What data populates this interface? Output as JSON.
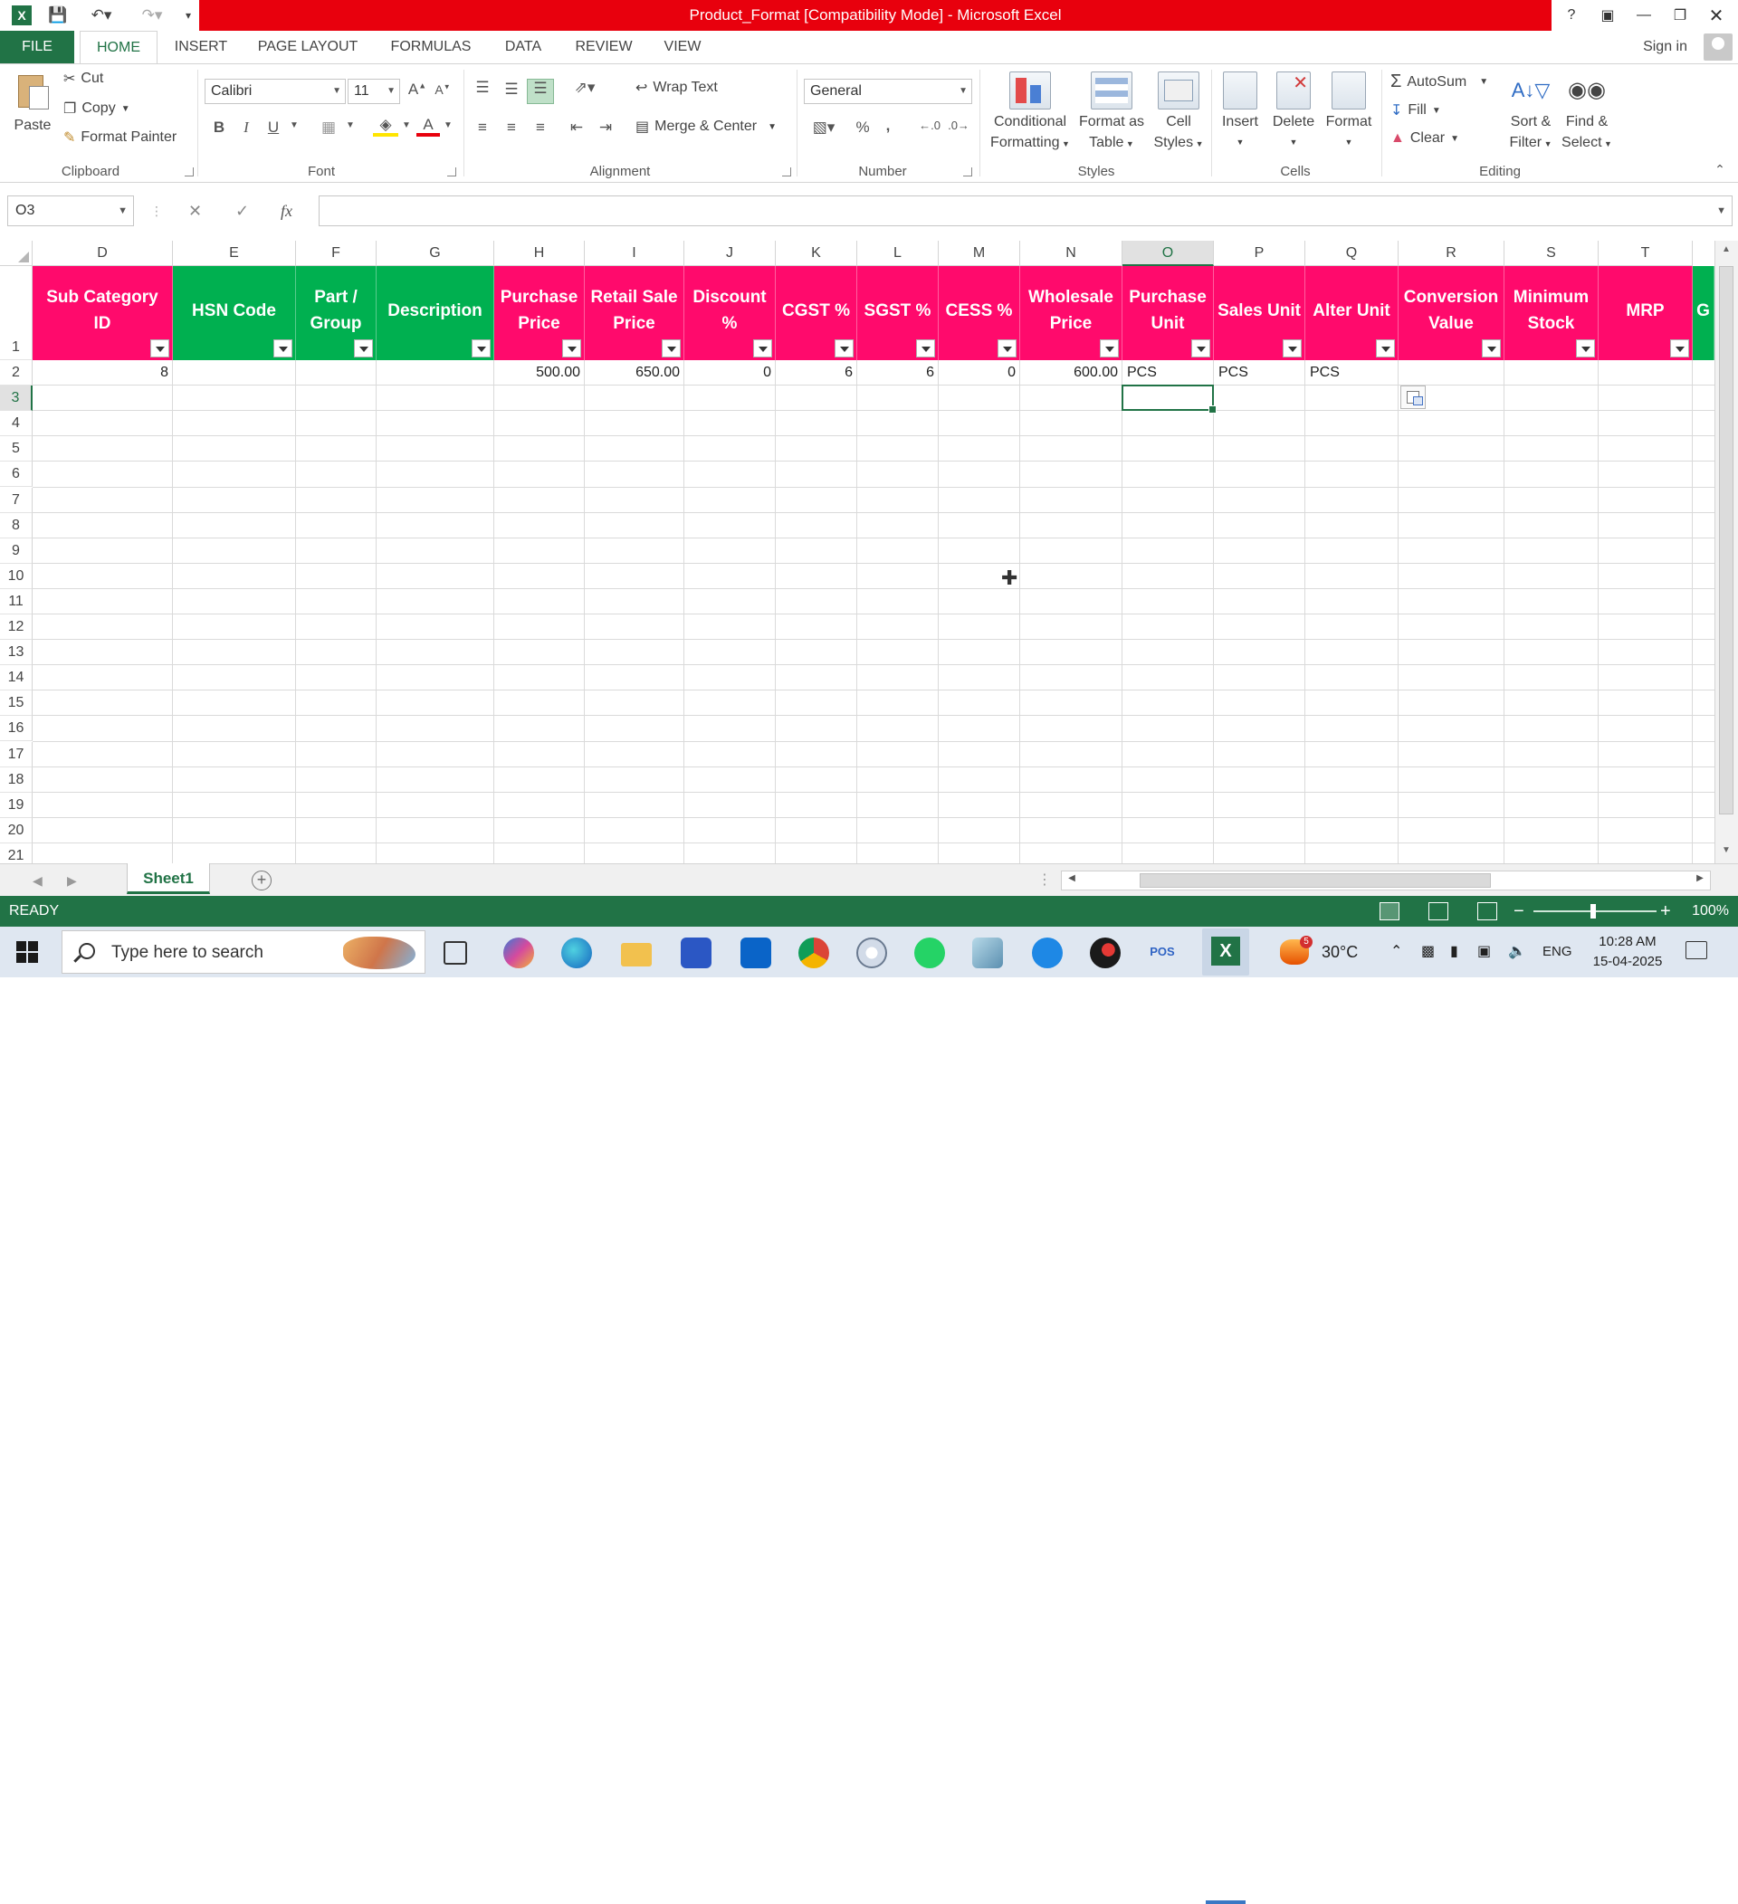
{
  "window": {
    "title": "Product_Format  [Compatibility Mode] - Microsoft Excel",
    "help": "?",
    "sign_in": "Sign in"
  },
  "ribbon_tabs": [
    "FILE",
    "HOME",
    "INSERT",
    "PAGE LAYOUT",
    "FORMULAS",
    "DATA",
    "REVIEW",
    "VIEW"
  ],
  "active_tab": "HOME",
  "clipboard": {
    "paste": "Paste",
    "cut": "Cut",
    "copy": "Copy",
    "format_painter": "Format Painter",
    "label": "Clipboard"
  },
  "font": {
    "name": "Calibri",
    "size": "11",
    "label": "Font",
    "bold": "B",
    "italic": "I",
    "underline": "U"
  },
  "alignment": {
    "wrap_text": "Wrap Text",
    "merge_center": "Merge & Center",
    "label": "Alignment"
  },
  "number": {
    "format": "General",
    "label": "Number",
    "percent": "%",
    "comma": ","
  },
  "styles": {
    "conditional_formatting": [
      "Conditional",
      "Formatting"
    ],
    "format_as_table": [
      "Format as",
      "Table"
    ],
    "cell_styles": [
      "Cell",
      "Styles"
    ],
    "label": "Styles"
  },
  "cells": {
    "insert": "Insert",
    "delete": "Delete",
    "format": "Format",
    "label": "Cells"
  },
  "editing": {
    "autosum": "AutoSum",
    "fill": "Fill",
    "clear": "Clear",
    "sort_filter": [
      "Sort &",
      "Filter"
    ],
    "find_select": [
      "Find &",
      "Select"
    ],
    "label": "Editing"
  },
  "formula_bar": {
    "name_box": "O3",
    "fx": "fx",
    "formula": ""
  },
  "columns": [
    "D",
    "E",
    "F",
    "G",
    "H",
    "I",
    "J",
    "K",
    "L",
    "M",
    "N",
    "O",
    "P",
    "Q",
    "R",
    "S",
    "T"
  ],
  "selected_column": "O",
  "header_row": [
    {
      "label": "Sub Category ID",
      "color": "pink"
    },
    {
      "label": "HSN Code",
      "color": "green"
    },
    {
      "label": "Part / Group",
      "color": "green"
    },
    {
      "label": "Description",
      "color": "green"
    },
    {
      "label": "Purchase Price",
      "color": "pink"
    },
    {
      "label": "Retail Sale Price",
      "color": "pink"
    },
    {
      "label": "Discount %",
      "color": "pink"
    },
    {
      "label": "CGST %",
      "color": "pink"
    },
    {
      "label": "SGST %",
      "color": "pink"
    },
    {
      "label": "CESS %",
      "color": "pink"
    },
    {
      "label": "Wholesale Price",
      "color": "pink"
    },
    {
      "label": "Purchase Unit",
      "color": "pink"
    },
    {
      "label": "Sales Unit",
      "color": "pink"
    },
    {
      "label": "Alter Unit",
      "color": "pink"
    },
    {
      "label": "Conversion Value",
      "color": "pink"
    },
    {
      "label": "Minimum Stock",
      "color": "pink"
    },
    {
      "label": "MRP",
      "color": "pink"
    },
    {
      "label": "G",
      "color": "green"
    }
  ],
  "data_row_2": [
    "8",
    "",
    "",
    "",
    "500.00",
    "650.00",
    "0",
    "6",
    "6",
    "0",
    "600.00",
    "PCS",
    "PCS",
    "PCS",
    "",
    "",
    ""
  ],
  "row_numbers": [
    "1",
    "2",
    "3",
    "4",
    "5",
    "6",
    "7",
    "8",
    "9",
    "10",
    "11",
    "12",
    "13",
    "14",
    "15",
    "16",
    "17",
    "18",
    "19",
    "20",
    "21"
  ],
  "selected_row": "3",
  "sheets": [
    "Sheet1"
  ],
  "status": {
    "text": "READY",
    "zoom": "100%",
    "zoom_minus": "−",
    "zoom_plus": "+"
  },
  "taskbar": {
    "search_placeholder": "Type here to search",
    "temperature": "30°C",
    "language": "ENG",
    "time": "10:28 AM",
    "date": "15-04-2025",
    "weather_badge": "5",
    "pos_label": "POS"
  },
  "colors": {
    "accent": "#217346",
    "title_red": "#e8000d",
    "header_pink": "#ff0a6c",
    "header_green": "#00b050"
  }
}
